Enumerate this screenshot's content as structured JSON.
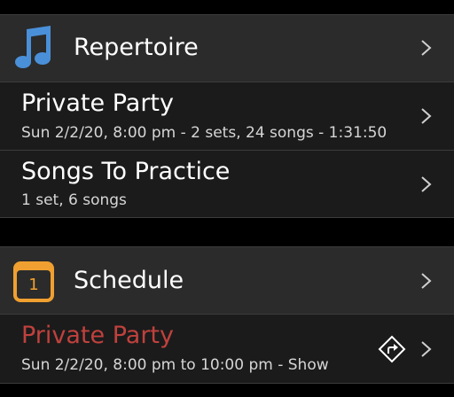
{
  "colors": {
    "background": "#000000",
    "header_bg": "#2b2b2b",
    "item_bg": "#1b1b1b",
    "music_icon": "#4a90d9",
    "calendar_icon": "#f0a030",
    "event_title": "#c0413d"
  },
  "repertoire": {
    "title": "Repertoire",
    "icon": "music-note-icon",
    "items": [
      {
        "title": "Private Party",
        "subtitle": "Sun 2/2/20, 8:00 pm - 2 sets, 24 songs - 1:31:50"
      },
      {
        "title": "Songs To Practice",
        "subtitle": "1 set, 6 songs"
      }
    ]
  },
  "schedule": {
    "title": "Schedule",
    "icon": "calendar-icon",
    "icon_day": "1",
    "items": [
      {
        "title": "Private Party",
        "subtitle": "Sun 2/2/20, 8:00 pm to 10:00 pm - Show",
        "action_icon": "directions-icon"
      }
    ]
  }
}
